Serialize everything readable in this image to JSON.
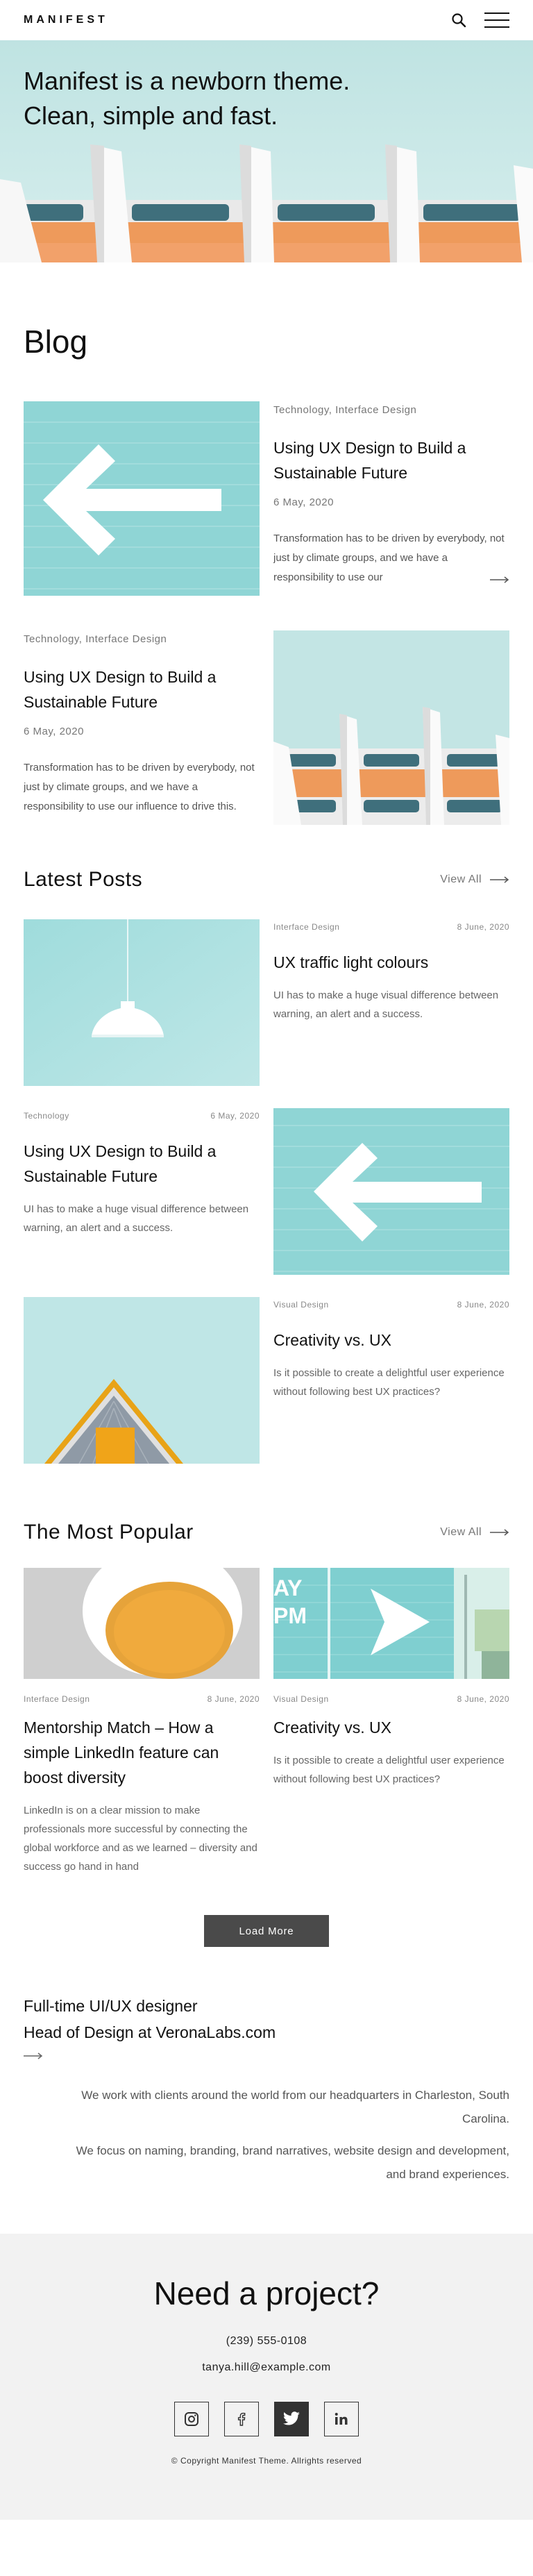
{
  "header": {
    "logo": "MANIFEST",
    "icons": [
      "search-icon",
      "menu-icon"
    ]
  },
  "hero": {
    "title_line1": "Manifest is a newborn theme.",
    "title_line2": "Clean, simple and fast."
  },
  "blog": {
    "title": "Blog",
    "items": [
      {
        "categories": "Technology, Interface Design",
        "title": "Using UX Design to Build a Sustainable Future",
        "date": "6 May, 2020",
        "excerpt": "Transformation has to be driven by everybody, not just by climate groups, and we have a responsibility to use our"
      },
      {
        "categories": "Technology, Interface Design",
        "title": "Using UX Design to Build a Sustainable Future",
        "date": "6 May, 2020",
        "excerpt": "Transformation has to be driven by everybody, not just by climate groups, and we have a responsibility to use our influence to drive this."
      }
    ]
  },
  "latest": {
    "title": "Latest Posts",
    "view_all": "View All",
    "items": [
      {
        "category": "Interface Design",
        "date": "8 June, 2020",
        "title": "UX traffic light colours",
        "excerpt": "UI has to make a huge visual difference between warning, an alert and a success."
      },
      {
        "category": "Technology",
        "date": "6 May, 2020",
        "title": "Using UX Design to Build a Sustainable Future",
        "excerpt": "UI has to make a huge visual difference between warning, an alert and a success."
      },
      {
        "category": "Visual Design",
        "date": "8 June, 2020",
        "title": "Creativity vs. UX",
        "excerpt": "Is it possible to create a delightful user experience without following best UX practices?"
      }
    ]
  },
  "popular": {
    "title": "The Most Popular",
    "view_all": "View All",
    "items": [
      {
        "category": "Interface Design",
        "date": "8 June, 2020",
        "title": "Mentorship Match – How a simple LinkedIn feature can boost diversity",
        "excerpt": "LinkedIn is on a clear mission to make professionals more successful by connecting the global workforce and as we learned – diversity and success go hand in hand"
      },
      {
        "category": "Visual Design",
        "date": "8 June, 2020",
        "title": "Creativity vs. UX",
        "excerpt": "Is it possible to create a delightful user experience without following best UX practices?",
        "image_text_1": "AY",
        "image_text_2": "PM"
      }
    ]
  },
  "load_more": "Load More",
  "about": {
    "line1": "Full-time UI/UX designer",
    "line2": "Head of Design at VeronaLabs.com",
    "para1": "We work with clients around the world from our headquarters in Charleston, South Carolina.",
    "para2": "We focus on naming, branding, brand narratives, website design and development, and brand experiences."
  },
  "footer": {
    "title": "Need a project?",
    "phone": "(239) 555-0108",
    "email": "tanya.hill@example.com",
    "socials": [
      "instagram-icon",
      "facebook-icon",
      "twitter-icon",
      "linkedin-icon"
    ],
    "copyright": "© Copyright Manifest Theme. Allrights reserved"
  },
  "colors": {
    "accent_teal": "#7fcfd0",
    "orange": "#ee9a5b",
    "button_dark": "#4a4a4a",
    "footer_bg": "#f2f2f2"
  }
}
